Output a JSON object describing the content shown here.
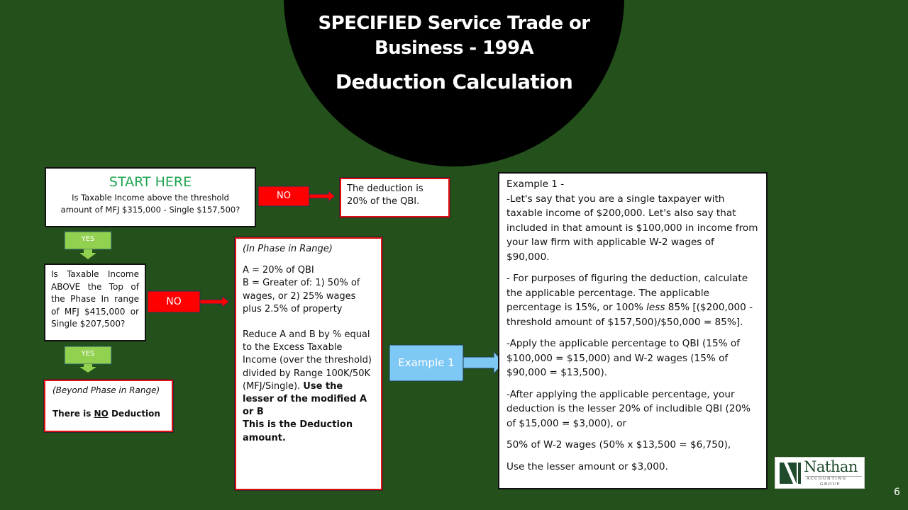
{
  "slide": {
    "title_line1": "SPECIFIED Service Trade or",
    "title_line1b": "Business - 199A",
    "title_line2": "Deduction Calculation",
    "page_number": "6"
  },
  "colors": {
    "background": "#24501b",
    "title_circle": "#000000",
    "start_green": "#1fa450",
    "yes_green": "#92d050",
    "no_red": "#ff0000",
    "example_blue": "#7ec8f5"
  },
  "flow": {
    "start_box": {
      "title": "START HERE",
      "question_line1": "Is Taxable Income above the threshold",
      "question_line2": "amount of MFJ $315,000 - Single $157,500?"
    },
    "no_arrow_1": "NO",
    "deduction_20_box": {
      "line1": "The deduction is",
      "line2": "20% of the QBI."
    },
    "yes_arrow_1": "YES",
    "phase_question_box": {
      "text": "Is Taxable Income ABOVE the Top of the Phase In range of MFJ $415,000 or Single $207,500?"
    },
    "no_arrow_2": "NO",
    "yes_arrow_2": "YES",
    "beyond_box": {
      "label": "(Beyond Phase in Range)",
      "text_before": "There is ",
      "text_underlined": "NO",
      "text_after": " Deduction"
    },
    "in_phase_box": {
      "label": "(In Phase in Range)",
      "line_a": "A = 20% of QBI",
      "line_b": "B = Greater of: 1) 50% of wages, or 2) 25% wages plus 2.5% of property",
      "reduce_text": "Reduce A and B by % equal to the Excess Taxable Income (over the threshold) divided by Range 100K/50K (MFJ/Single). ",
      "reduce_bold": "Use the lesser of the modified A or B",
      "final_bold": "This is the Deduction amount."
    },
    "example_arrow": "Example 1"
  },
  "example": {
    "heading": "Example 1 -",
    "p1": "-Let's say that you are a single taxpayer with taxable income of $200,000. Let's also say that included in that amount is $100,000 in income from your law firm with applicable W-2 wages of $90,000.",
    "p2_before": "- For purposes of figuring the deduction, calculate the applicable percentage. The applicable percentage is 15%, or 100% ",
    "p2_italic": "less",
    "p2_after": " 85% [($200,000 - threshold amount of $157,500)/$50,000 = 85%].",
    "p3": "-Apply the applicable percentage to QBI (15% of $100,000 = $15,000) and W-2 wages (15% of $90,000 = $13,500).",
    "p4": "-After applying the applicable percentage, your deduction is the lesser 20% of includible QBI (20% of $15,000 = $3,000), or",
    "p5": "50% of W-2 wages (50% x $13,500 = $6,750),",
    "p6": "Use the lesser amount or $3,000."
  },
  "logo": {
    "name": "Nathan",
    "sub1": "ACCOUNTING",
    "sub2": "GROUP"
  }
}
